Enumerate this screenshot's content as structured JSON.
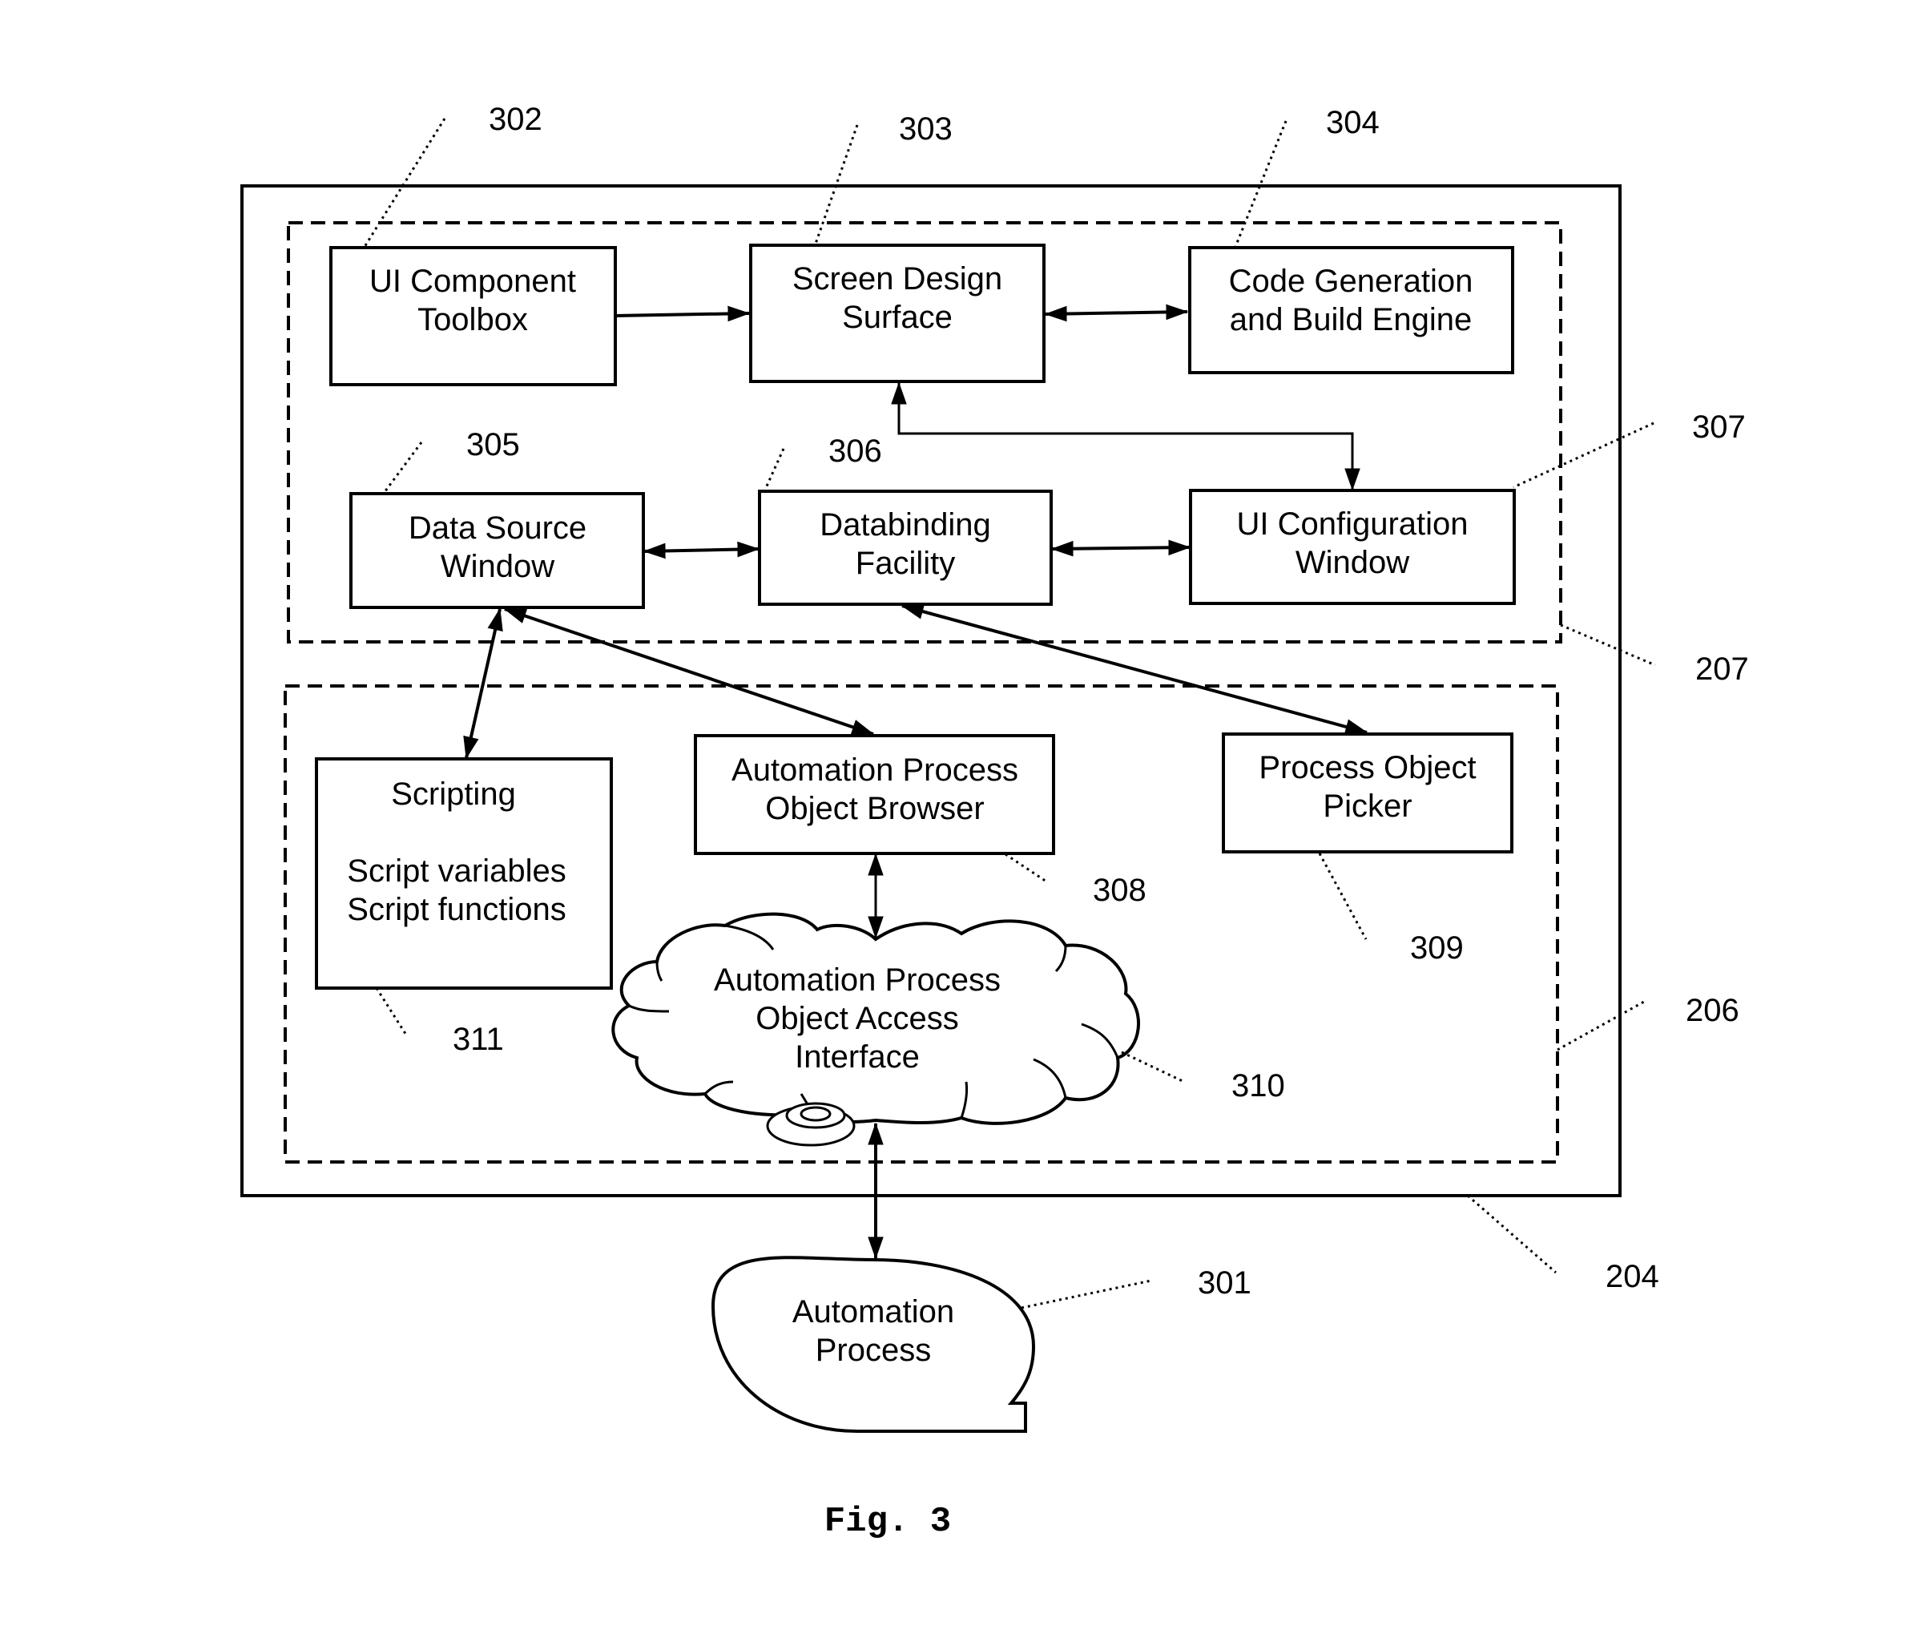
{
  "figure": {
    "caption": "Fig. 3",
    "containers": {
      "outer_system": {
        "ref": "204"
      },
      "design_environment": {
        "ref": "207"
      },
      "runtime_environment": {
        "ref": "206"
      }
    },
    "components": {
      "ui_component_toolbox": {
        "ref": "302",
        "lines": [
          "UI Component",
          "Toolbox"
        ]
      },
      "screen_design_surface": {
        "ref": "303",
        "lines": [
          "Screen Design",
          "Surface"
        ]
      },
      "code_generation_engine": {
        "ref": "304",
        "lines": [
          "Code Generation",
          "and Build Engine"
        ]
      },
      "data_source_window": {
        "ref": "305",
        "lines": [
          "Data Source",
          "Window"
        ]
      },
      "databinding_facility": {
        "ref": "306",
        "lines": [
          "Databinding",
          "Facility"
        ]
      },
      "ui_configuration_window": {
        "ref": "307",
        "lines": [
          "UI Configuration",
          "Window"
        ]
      },
      "object_browser": {
        "ref": "308",
        "lines": [
          "Automation Process",
          "Object Browser"
        ]
      },
      "process_object_picker": {
        "ref": "309",
        "lines": [
          "Process Object",
          "Picker"
        ]
      },
      "object_access_interface": {
        "ref": "310",
        "lines": [
          "Automation Process",
          "Object Access",
          "Interface"
        ]
      },
      "scripting": {
        "ref": "311",
        "title": "Scripting",
        "lines": [
          "Script variables",
          "Script functions"
        ]
      },
      "automation_process": {
        "ref": "301",
        "lines": [
          "Automation",
          "Process"
        ]
      }
    },
    "connections": [
      {
        "from": "UI Component Toolbox",
        "to": "Screen Design Surface",
        "direction": "one-way"
      },
      {
        "from": "Screen Design Surface",
        "to": "Code Generation and Build Engine",
        "direction": "two-way"
      },
      {
        "from": "Screen Design Surface",
        "to": "UI Configuration Window",
        "direction": "two-way"
      },
      {
        "from": "Data Source Window",
        "to": "Databinding Facility",
        "direction": "two-way"
      },
      {
        "from": "Databinding Facility",
        "to": "UI Configuration Window",
        "direction": "two-way"
      },
      {
        "from": "Data Source Window",
        "to": "Scripting",
        "direction": "two-way"
      },
      {
        "from": "Data Source Window",
        "to": "Automation Process Object Browser",
        "direction": "two-way"
      },
      {
        "from": "Databinding Facility",
        "to": "Process Object Picker",
        "direction": "two-way"
      },
      {
        "from": "Automation Process Object Browser",
        "to": "Automation Process Object Access Interface",
        "direction": "two-way"
      },
      {
        "from": "Automation Process Object Access Interface",
        "to": "Automation Process",
        "direction": "two-way"
      }
    ]
  }
}
